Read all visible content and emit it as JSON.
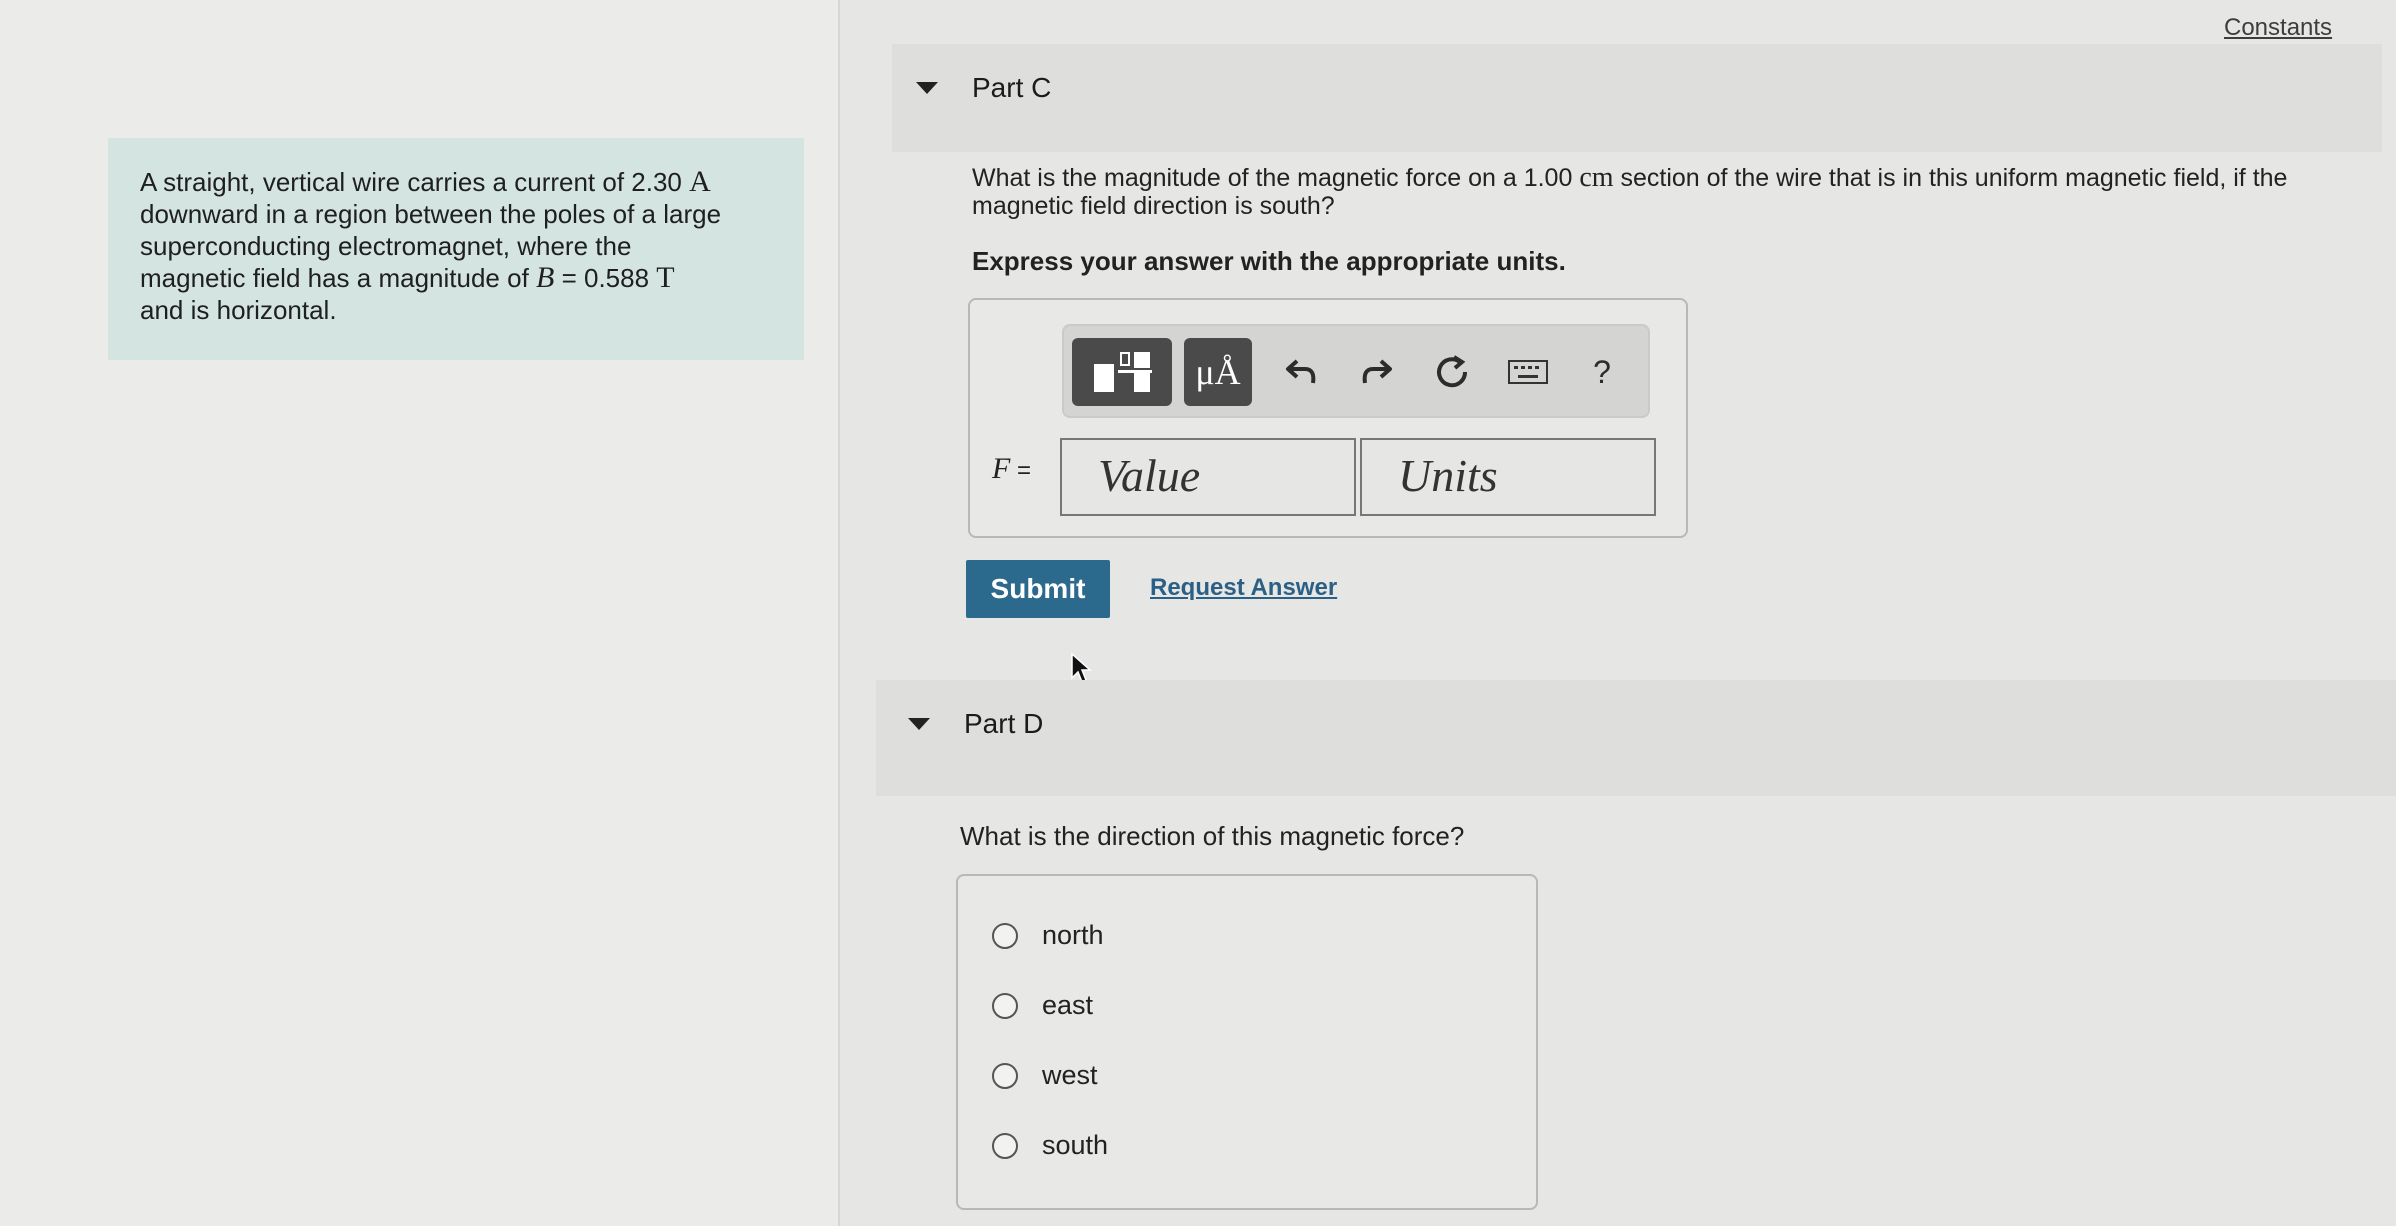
{
  "intro": {
    "line1_pre": "A straight, vertical wire carries a current of 2.30 ",
    "current_unit": "A",
    "line2": "downward in a region between the poles of a large",
    "line3": "superconducting electromagnet, where the",
    "line4_pre": "magnetic field has a magnitude of ",
    "field_symbol": "B",
    "field_eq": " = 0.588 ",
    "field_unit": "T",
    "line5": "and is horizontal."
  },
  "constants_link": "Constants",
  "partC": {
    "title": "Part C",
    "question_pre": "What is the magnitude of the magnetic force on a 1.00 ",
    "question_unit": "cm",
    "question_post": " section of the wire that is in this uniform magnetic field, if the",
    "question_line2": "magnetic field direction is south?",
    "instruction": "Express your answer with the appropriate units.",
    "toolbar": {
      "template_icon": "templates-icon",
      "units_icon_label": "μÅ",
      "undo_icon": "undo-icon",
      "redo_icon": "redo-icon",
      "reset_icon": "reset-icon",
      "keyboard_icon": "keyboard-icon",
      "help_label": "?"
    },
    "answer_symbol": "F",
    "answer_eq": " =",
    "value_placeholder": "Value",
    "units_placeholder": "Units",
    "submit_label": "Submit",
    "request_label": "Request Answer"
  },
  "partD": {
    "title": "Part D",
    "question": "What is the direction of this magnetic force?",
    "options": [
      "north",
      "east",
      "west",
      "south"
    ]
  }
}
